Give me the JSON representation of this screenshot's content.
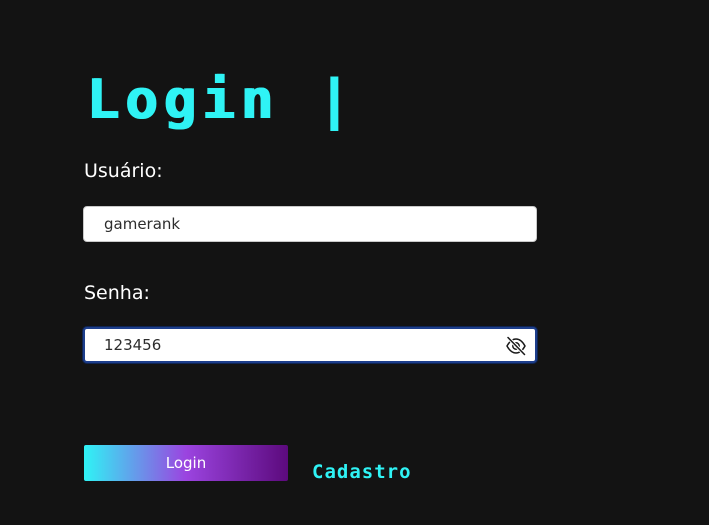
{
  "form": {
    "title": "Login",
    "title_cursor": "|",
    "user_label": "Usuário:",
    "user_value": "gamerank",
    "password_label": "Senha:",
    "password_value": "123456",
    "password_visibility_icon": "eye-off-icon",
    "login_label": "Login",
    "register_label": "Cadastro"
  },
  "colors": {
    "background": "#131313",
    "accent": "#2ff3f5",
    "gradient_mid": "#9b44e0",
    "gradient_end": "#5c0a7d",
    "focus_border": "#1d3e8c"
  }
}
